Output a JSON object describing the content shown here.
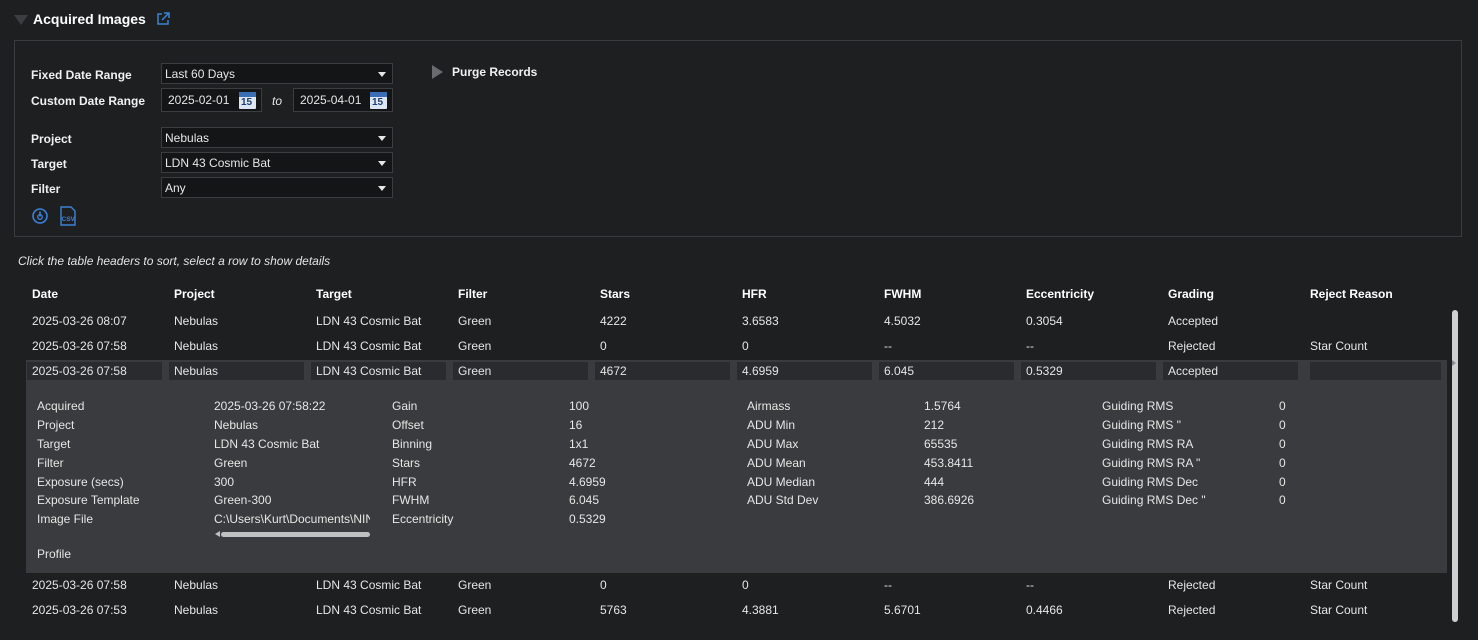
{
  "header": {
    "title": "Acquired Images",
    "link_icon": "external-link-icon"
  },
  "filters": {
    "fixed_date_range_label": "Fixed Date Range",
    "fixed_date_range_value": "Last 60 Days",
    "custom_date_range_label": "Custom Date Range",
    "date_from": "2025-02-01",
    "date_to_label": "to",
    "date_to": "2025-04-01",
    "calendar_day": "15",
    "project_label": "Project",
    "project_value": "Nebulas",
    "target_label": "Target",
    "target_value": "LDN 43 Cosmic Bat",
    "filter_label": "Filter",
    "filter_value": "Any",
    "purge_label": "Purge Records",
    "refresh_icon": "refresh-icon",
    "csv_icon": "csv-export-icon",
    "csv_text": "CSV"
  },
  "hint": "Click the table headers to sort, select a row to show details",
  "table": {
    "columns": [
      "Date",
      "Project",
      "Target",
      "Filter",
      "Stars",
      "HFR",
      "FWHM",
      "Eccentricity",
      "Grading",
      "Reject Reason"
    ],
    "rows": [
      [
        "2025-03-26 08:07",
        "Nebulas",
        "LDN 43 Cosmic Bat",
        "Green",
        "4222",
        "3.6583",
        "4.5032",
        "0.3054",
        "Accepted",
        ""
      ],
      [
        "2025-03-26 07:58",
        "Nebulas",
        "LDN 43 Cosmic Bat",
        "Green",
        "0",
        "0",
        "--",
        "--",
        "Rejected",
        "Star Count"
      ],
      [
        "2025-03-26 07:58",
        "Nebulas",
        "LDN 43 Cosmic Bat",
        "Green",
        "4672",
        "4.6959",
        "6.045",
        "0.5329",
        "Accepted",
        ""
      ],
      [
        "2025-03-26 07:58",
        "Nebulas",
        "LDN 43 Cosmic Bat",
        "Green",
        "0",
        "0",
        "--",
        "--",
        "Rejected",
        "Star Count"
      ],
      [
        "2025-03-26 07:53",
        "Nebulas",
        "LDN 43 Cosmic Bat",
        "Green",
        "5763",
        "4.3881",
        "5.6701",
        "0.4466",
        "Rejected",
        "Star Count"
      ]
    ]
  },
  "details": {
    "col1": [
      [
        "Acquired",
        "2025-03-26 07:58:22"
      ],
      [
        "Project",
        "Nebulas"
      ],
      [
        "Target",
        "LDN 43 Cosmic Bat"
      ],
      [
        "Filter",
        "Green"
      ],
      [
        "Exposure (secs)",
        "300"
      ],
      [
        "Exposure Template",
        "Green-300"
      ],
      [
        "Image File",
        "C:\\Users\\Kurt\\Documents\\NIN"
      ]
    ],
    "col2": [
      [
        "Gain",
        "100"
      ],
      [
        "Offset",
        "16"
      ],
      [
        "Binning",
        "1x1"
      ],
      [
        "Stars",
        "4672"
      ],
      [
        "HFR",
        "4.6959"
      ],
      [
        "FWHM",
        "6.045"
      ],
      [
        "Eccentricity",
        "0.5329"
      ]
    ],
    "col3": [
      [
        "Airmass",
        "1.5764"
      ],
      [
        "ADU Min",
        "212"
      ],
      [
        "ADU Max",
        "65535"
      ],
      [
        "ADU Mean",
        "453.8411"
      ],
      [
        "ADU Median",
        "444"
      ],
      [
        "ADU Std Dev",
        "386.6926"
      ]
    ],
    "col4": [
      [
        "Guiding RMS",
        "0"
      ],
      [
        "Guiding RMS \"",
        "0"
      ],
      [
        "Guiding RMS RA",
        "0"
      ],
      [
        "Guiding RMS RA \"",
        "0"
      ],
      [
        "Guiding RMS Dec",
        "0"
      ],
      [
        "Guiding RMS Dec \"",
        "0"
      ]
    ],
    "profile_label": "Profile"
  },
  "colors": {
    "background": "#1e1f21",
    "detail_panel": "#3a3b3e",
    "accent_link": "#3b82d6"
  }
}
